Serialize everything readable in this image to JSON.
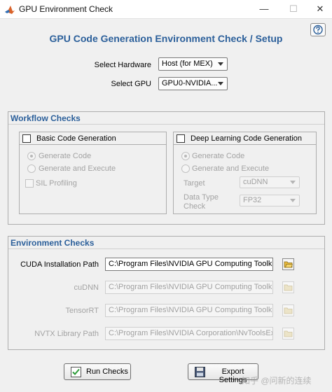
{
  "window": {
    "title": "GPU Environment Check",
    "controls": {
      "minimize": "—",
      "maximize": "☐",
      "close": "✕"
    }
  },
  "help": {
    "icon": "help-icon"
  },
  "heading": "GPU Code Generation Environment Check / Setup",
  "hardware": {
    "label": "Select Hardware",
    "value": "Host (for MEX)"
  },
  "gpu": {
    "label": "Select GPU",
    "value": "GPU0-NVIDIA..."
  },
  "workflow": {
    "title": "Workflow Checks",
    "basic": {
      "label": "Basic Code Generation",
      "checked": false,
      "radio_generate": "Generate Code",
      "radio_execute": "Generate and Execute",
      "sil": "SIL Profiling"
    },
    "deep": {
      "label": "Deep Learning Code Generation",
      "checked": false,
      "radio_generate": "Generate Code",
      "radio_execute": "Generate and Execute",
      "target_label": "Target",
      "target_value": "cuDNN",
      "datatype_label_line1": "Data Type",
      "datatype_label_line2": "Check",
      "datatype_value": "FP32"
    }
  },
  "environment": {
    "title": "Environment Checks",
    "rows": [
      {
        "label": "CUDA Installation Path",
        "value": "C:\\Program Files\\NVIDIA GPU Computing Toolkit\\CUD",
        "enabled": true
      },
      {
        "label": "cuDNN",
        "value": "C:\\Program Files\\NVIDIA GPU Computing Toolkit\\CUD",
        "enabled": false
      },
      {
        "label": "TensorRT",
        "value": "C:\\Program Files\\NVIDIA GPU Computing Toolkit\\CUD",
        "enabled": false
      },
      {
        "label": "NVTX Library Path",
        "value": "C:\\Program Files\\NVIDIA Corporation\\NvToolsExt\\lib",
        "enabled": false
      }
    ]
  },
  "buttons": {
    "run_checks": "Run Checks",
    "export_settings": "Export Settings"
  },
  "watermark": "知乎 @问新的连续",
  "colors": {
    "accent": "#2b5f9a",
    "disabled_text": "#a3a3a3",
    "background": "#f0f0f0"
  }
}
